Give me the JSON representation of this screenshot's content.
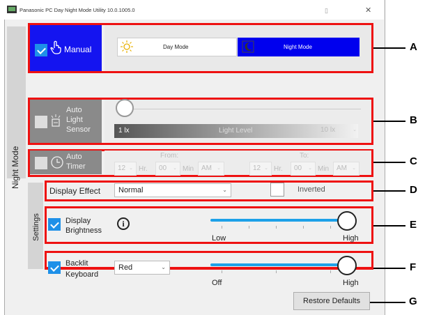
{
  "window": {
    "title": "Panasonic PC Day Night Mode Utility 10.0.1005.0",
    "close_glyph": "✕",
    "restore_glyph": "⬚"
  },
  "side_labels": {
    "night_mode": "Night Mode",
    "settings": "Settings"
  },
  "manual": {
    "label": "Manual",
    "checked": true,
    "day_mode_label": "Day Mode",
    "night_mode_label": "Night Mode",
    "selected": "Night Mode"
  },
  "auto_light_sensor": {
    "label_line1": "Auto",
    "label_line2": "Light",
    "label_line3": "Sensor",
    "checked": false,
    "min_label": "1 lx",
    "level_label": "Light Level",
    "threshold_value": "10 lx"
  },
  "auto_timer": {
    "label_line1": "Auto",
    "label_line2": "Timer",
    "checked": false,
    "from_label": "From:",
    "to_label": "To:",
    "from": {
      "hour": "12",
      "hr_label": "Hr.",
      "minute": "00",
      "min_label": "Min",
      "ampm": "AM"
    },
    "to": {
      "hour": "12",
      "hr_label": "Hr.",
      "minute": "00",
      "min_label": "Min",
      "ampm": "AM"
    }
  },
  "display_effect": {
    "label": "Display Effect",
    "value": "Normal",
    "inverted_label": "Inverted",
    "inverted_checked": false
  },
  "display_brightness": {
    "label_line1": "Display",
    "label_line2": "Brightness",
    "checked": true,
    "info_glyph": "i",
    "low_label": "Low",
    "high_label": "High",
    "level": 1.0
  },
  "backlit_keyboard": {
    "label_line1": "Backlit",
    "label_line2": "Keyboard",
    "checked": true,
    "color_value": "Red",
    "off_label": "Off",
    "high_label": "High",
    "level": 1.0
  },
  "restore_defaults_label": "Restore Defaults",
  "annotations": [
    "A",
    "B",
    "C",
    "D",
    "E",
    "F",
    "G"
  ],
  "colors": {
    "accent_blue": "#1e90e8",
    "manual_bg": "#1414f0",
    "night_btn_bg": "#0000ee",
    "disabled_gray": "#8a8a8a",
    "highlight_red": "#e11111"
  }
}
